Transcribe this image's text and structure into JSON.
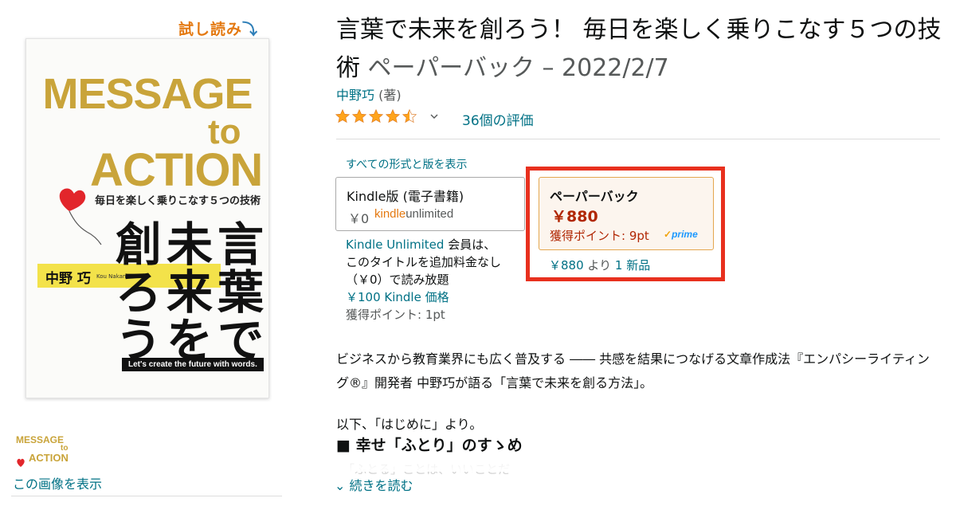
{
  "look_inside": {
    "label": "試し読み",
    "arrow": "⤵"
  },
  "cover": {
    "title_line1": "MESSAGE",
    "title_line2": "to",
    "title_line3": "ACTION",
    "subtitle": "毎日を楽しく乗りこなす５つの技術",
    "vertical_col1": "言葉で",
    "vertical_col2": "未来を",
    "vertical_col3": "創ろう",
    "author": "中野 巧",
    "author_en": "Kou Nakano",
    "tagline": "Let's create the future with words."
  },
  "thumbnail": {
    "line1": "MESSAGE",
    "line2": "to",
    "line3": "ACTION"
  },
  "view_image_link": "この画像を表示",
  "product": {
    "title": "言葉で未来を創ろう！ 毎日を楽しく乗りこなす５つの技術",
    "binding_date": "ペーパーバック – 2022/2/7",
    "author": "中野巧",
    "author_role": "(著)",
    "rating_stars": 4.5,
    "rating_count": "36個の評価"
  },
  "formats": {
    "all_formats_link": "すべての形式と版を表示",
    "kindle": {
      "label": "Kindle版 (電子書籍)",
      "price": "￥0",
      "ku_logo_kindle": "kindle",
      "ku_logo_unlimited": "unlimited"
    },
    "kindle_note": {
      "ku_link": "Kindle Unlimited",
      "ku_text": " 会員は、",
      "line2": "このタイトルを追加料金なし",
      "line3": "（￥0）で読み放題",
      "price_line": "￥100 Kindle 価格",
      "points": "獲得ポイント: 1pt"
    },
    "paperback": {
      "label": "ペーパーバック",
      "price": "￥880",
      "points": "獲得ポイント: 9pt",
      "prime_tick": "✓",
      "prime": "prime",
      "offer_price": "￥880",
      "offer_from": " より ",
      "offer_link": "1 新品"
    }
  },
  "description": {
    "para1": "ビジネスから教育業界にも広く普及する ―― 共感を結果につなげる文章作成法『エンパシーライティング®』開発者 中野巧が語る「言葉で未来を創る方法」。",
    "para2": "以下、「はじめに」より。",
    "heading": "■ 幸せ「ふとり」のすゝめ",
    "fade_text": "「ふとる」ことは、いいことだ",
    "read_more": "続きを読む"
  },
  "colors": {
    "link": "#007185",
    "price": "#b12704",
    "highlight": "#e8301e",
    "star": "#ffa41c",
    "cover_gold": "#c9a43a"
  },
  "icons": {
    "star": "star-icon",
    "half_star": "half-star-icon",
    "chevron": "chevron-down-icon",
    "heart": "heart-balloon-icon"
  }
}
